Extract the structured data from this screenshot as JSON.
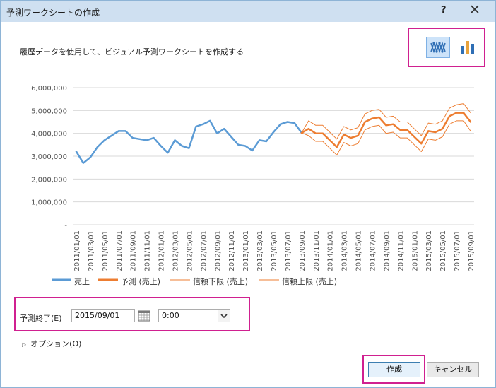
{
  "window": {
    "title": "予測ワークシートの作成",
    "help_label": "?",
    "close_label": "✕"
  },
  "description": "履歴データを使用して、ビジュアル予測ワークシートを作成する",
  "chart_types": [
    {
      "name": "line",
      "icon": "line-chart-icon",
      "selected": true
    },
    {
      "name": "column",
      "icon": "column-chart-icon",
      "selected": false
    }
  ],
  "colors": {
    "actual": "#5b9bd5",
    "forecast": "#ed7d31",
    "highlight": "#d02090",
    "gridline": "#d9d9d9"
  },
  "chart_data": {
    "type": "line",
    "y_ticks": [
      "6,000,000",
      "5,000,000",
      "4,000,000",
      "3,000,000",
      "2,000,000",
      "1,000,000",
      "-"
    ],
    "ylim": [
      0,
      6000000
    ],
    "x_tick_labels": [
      "2011/01/01",
      "2011/03/01",
      "2011/05/01",
      "2011/07/01",
      "2011/09/01",
      "2011/11/01",
      "2012/01/01",
      "2012/03/01",
      "2012/05/01",
      "2012/07/01",
      "2012/09/01",
      "2012/11/01",
      "2013/01/01",
      "2013/03/01",
      "2013/05/01",
      "2013/07/01",
      "2013/09/01",
      "2013/11/01",
      "2014/01/01",
      "2014/03/01",
      "2014/05/01",
      "2014/07/01",
      "2014/09/01",
      "2014/11/01",
      "2015/01/01",
      "2015/03/01",
      "2015/05/01",
      "2015/07/01",
      "2015/09/01"
    ],
    "grid": true,
    "legend_position": "bottom",
    "series": [
      {
        "name": "売上",
        "values": [
          3200000,
          2700000,
          2950000,
          3400000,
          3700000,
          3900000,
          4100000,
          4100000,
          3800000,
          3750000,
          3700000,
          3800000,
          3450000,
          3150000,
          3700000,
          3450000,
          3350000,
          4300000,
          4400000,
          4550000,
          4000000,
          4200000,
          3850000,
          3500000,
          3450000,
          3250000,
          3700000,
          3650000,
          4050000,
          4400000,
          4500000,
          4450000,
          4020000
        ]
      },
      {
        "name": "予測 (売上)",
        "values": [
          4020000,
          4200000,
          4000000,
          4000000,
          3700000,
          3400000,
          3950000,
          3800000,
          3900000,
          4500000,
          4650000,
          4700000,
          4350000,
          4400000,
          4150000,
          4150000,
          3850000,
          3550000,
          4100000,
          4050000,
          4200000,
          4750000,
          4900000,
          4900000,
          4500000
        ]
      },
      {
        "name": "信頼下限 (売上)",
        "values": [
          4020000,
          3900000,
          3650000,
          3650000,
          3350000,
          3050000,
          3600000,
          3450000,
          3550000,
          4150000,
          4300000,
          4350000,
          4000000,
          4050000,
          3800000,
          3800000,
          3500000,
          3200000,
          3750000,
          3700000,
          3850000,
          4400000,
          4550000,
          4550000,
          4100000
        ]
      },
      {
        "name": "信頼上限 (売上)",
        "values": [
          4020000,
          4550000,
          4350000,
          4350000,
          4050000,
          3750000,
          4300000,
          4150000,
          4250000,
          4850000,
          5000000,
          5050000,
          4700000,
          4750000,
          4500000,
          4500000,
          4200000,
          3900000,
          4450000,
          4400000,
          4550000,
          5100000,
          5250000,
          5300000,
          4900000
        ]
      }
    ]
  },
  "forecast_end": {
    "label": "予測終了(E)",
    "date_value": "2015/09/01",
    "time_value": "0:00"
  },
  "options_label": "オプション(O)",
  "buttons": {
    "create": "作成",
    "cancel": "キャンセル"
  }
}
